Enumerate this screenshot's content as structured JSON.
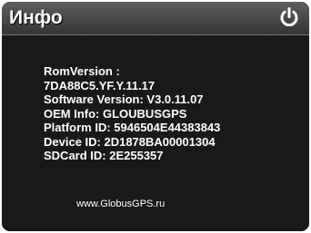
{
  "header": {
    "title": "Инфо",
    "power_icon": "power-icon"
  },
  "info_lines": {
    "rom_version_label": "RomVersion :",
    "rom_version_value": "7DA88C5.YF.Y.11.17",
    "software_version": "Software Version: V3.0.11.07",
    "oem_info": "OEM Info: GLOUBUSGPS",
    "platform_id": "Platform ID: 5946504E44383843",
    "device_id": "Device ID: 2D1878BA00001304",
    "sdcard_id": "SDCard ID: 2E255357"
  },
  "footer": {
    "website": "www.GlobusGPS.ru"
  },
  "colors": {
    "background": "#191919",
    "title_bar": "#4a4a4a",
    "text": "#ffffff"
  }
}
